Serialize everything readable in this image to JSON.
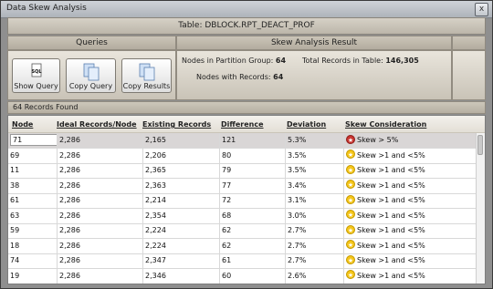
{
  "window": {
    "title": "Data Skew Analysis",
    "close_glyph": "x"
  },
  "table_label": "Table: DBLOCK.RPT_DEACT_PROF",
  "queries": {
    "title": "Queries",
    "buttons": [
      {
        "label": "Show Query",
        "icon": "sql-query-icon"
      },
      {
        "label": "Copy Query",
        "icon": "copy-document-icon"
      },
      {
        "label": "Copy Results",
        "icon": "copy-document-icon"
      }
    ],
    "sql_icon_text": "SQL"
  },
  "skew_result": {
    "title": "Skew Analysis Result",
    "nodes_in_partition_label": "Nodes in Partition Group:",
    "nodes_in_partition_value": "64",
    "total_records_label": "Total Records in Table:",
    "total_records_value": "146,305",
    "nodes_with_records_label": "Nodes with Records:",
    "nodes_with_records_value": "64"
  },
  "records_found": "64 Records Found",
  "grid": {
    "columns": [
      "Node",
      "Ideal Records/Node",
      "Existing Records",
      "Difference",
      "Deviation",
      "Skew Consideration"
    ],
    "rows": [
      {
        "node": "71",
        "ideal": "2,286",
        "existing": "2,165",
        "difference": "121",
        "deviation": "5.3%",
        "skew": "Skew > 5%",
        "level": "red"
      },
      {
        "node": "69",
        "ideal": "2,286",
        "existing": "2,206",
        "difference": "80",
        "deviation": "3.5%",
        "skew": "Skew >1 and <5%",
        "level": "yellow"
      },
      {
        "node": "11",
        "ideal": "2,286",
        "existing": "2,365",
        "difference": "79",
        "deviation": "3.5%",
        "skew": "Skew >1 and <5%",
        "level": "yellow"
      },
      {
        "node": "38",
        "ideal": "2,286",
        "existing": "2,363",
        "difference": "77",
        "deviation": "3.4%",
        "skew": "Skew >1 and <5%",
        "level": "yellow"
      },
      {
        "node": "61",
        "ideal": "2,286",
        "existing": "2,214",
        "difference": "72",
        "deviation": "3.1%",
        "skew": "Skew >1 and <5%",
        "level": "yellow"
      },
      {
        "node": "63",
        "ideal": "2,286",
        "existing": "2,354",
        "difference": "68",
        "deviation": "3.0%",
        "skew": "Skew >1 and <5%",
        "level": "yellow"
      },
      {
        "node": "59",
        "ideal": "2,286",
        "existing": "2,224",
        "difference": "62",
        "deviation": "2.7%",
        "skew": "Skew >1 and <5%",
        "level": "yellow"
      },
      {
        "node": "18",
        "ideal": "2,286",
        "existing": "2,224",
        "difference": "62",
        "deviation": "2.7%",
        "skew": "Skew >1 and <5%",
        "level": "yellow"
      },
      {
        "node": "74",
        "ideal": "2,286",
        "existing": "2,347",
        "difference": "61",
        "deviation": "2.7%",
        "skew": "Skew >1 and <5%",
        "level": "yellow"
      },
      {
        "node": "19",
        "ideal": "2,286",
        "existing": "2,346",
        "difference": "60",
        "deviation": "2.6%",
        "skew": "Skew >1 and <5%",
        "level": "yellow"
      }
    ]
  },
  "colors": {
    "skew_high": "#c8332e",
    "skew_medium": "#f5c518",
    "selected_row": "#d9d6d6"
  }
}
